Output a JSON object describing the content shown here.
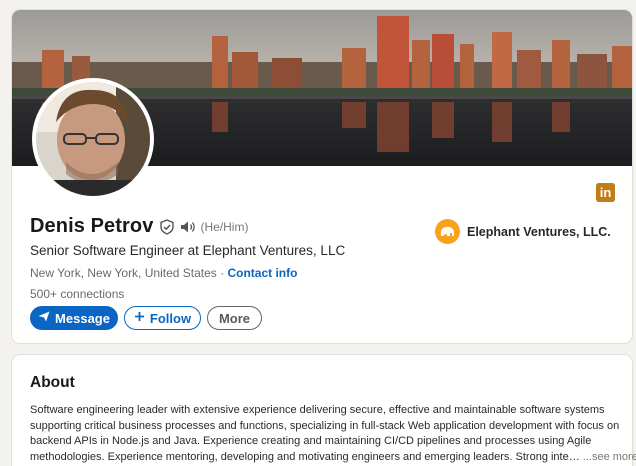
{
  "profile": {
    "name": "Denis Petrov",
    "pronouns": "(He/Him)",
    "headline": "Senior Software Engineer at Elephant Ventures, LLC",
    "location": "New York, New York, United States",
    "location_separator": " · ",
    "contact_info": "Contact info",
    "connections": "500+ connections",
    "linkedin_badge": "in"
  },
  "company": {
    "name": "Elephant Ventures, LLC."
  },
  "actions": {
    "message": "Message",
    "follow": "Follow",
    "more": "More"
  },
  "about": {
    "title": "About",
    "lines": [
      "Software engineering leader with extensive experience delivering secure, effective and maintainable software systems",
      "supporting critical business processes and functions, specializing in full-stack Web application development with focus on",
      "backend APIs in Node.js and Java. Experience creating and maintaining CI/CD pipelines and processes using Agile",
      "methodologies. Experience mentoring, developing and motivating engineers and emerging leaders. Strong inte"
    ],
    "truncation": "…",
    "see_more": "...see more"
  },
  "icons": {
    "verified": "verified-shield-icon",
    "pronunciation": "speaker-icon",
    "message": "paper-plane-icon",
    "follow": "plus-icon",
    "company_logo": "elephant-logo-icon"
  },
  "colors": {
    "brand_blue": "#0a66c2",
    "company_orange": "#f6a21a",
    "badge_gold": "#c37d16"
  }
}
